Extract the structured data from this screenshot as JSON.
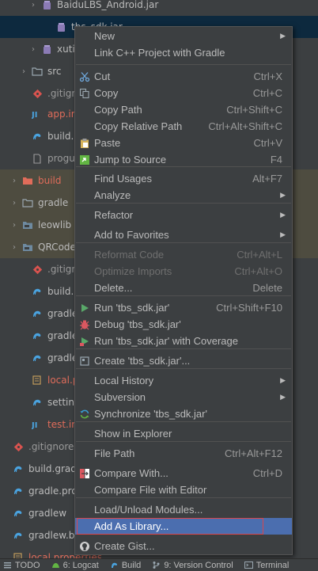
{
  "tree": {
    "rows": [
      {
        "label": "BaiduLBS_Android.jar",
        "icon": "jar-icon",
        "color": "#bbbbbb",
        "arrow": "›"
      },
      {
        "label": "tbs_sdk.jar",
        "icon": "jar-icon",
        "color": "#bbbbbb",
        "arrow": ""
      },
      {
        "label": "xutils",
        "icon": "jar-icon",
        "color": "#bbbbbb",
        "arrow": "›"
      },
      {
        "label": "src",
        "icon": "folder-icon",
        "color": "#bbbbbb",
        "arrow": "›"
      },
      {
        "label": ".gitignore",
        "icon": "gitignore-icon",
        "color": "#9a9a9a",
        "arrow": ""
      },
      {
        "label": "app.iml",
        "icon": "iml-icon",
        "color": "#e06c5a",
        "arrow": ""
      },
      {
        "label": "build.gradle",
        "icon": "gradle-icon",
        "color": "#bbbbbb",
        "arrow": ""
      },
      {
        "label": "proguard-rules.pro",
        "icon": "file-icon",
        "color": "#9a9a9a",
        "arrow": ""
      },
      {
        "label": "build",
        "icon": "folder-red-icon",
        "color": "#e06c5a",
        "arrow": "›"
      },
      {
        "label": "gradle",
        "icon": "folder-icon",
        "color": "#bbbbbb",
        "arrow": "›"
      },
      {
        "label": "leowlib",
        "icon": "module-icon",
        "color": "#bbbbbb",
        "arrow": "›"
      },
      {
        "label": "QRCodeLib",
        "icon": "module-icon",
        "color": "#bbbbbb",
        "arrow": "›"
      },
      {
        "label": ".gitignore",
        "icon": "gitignore-icon",
        "color": "#9a9a9a",
        "arrow": ""
      },
      {
        "label": "build.gradle",
        "icon": "gradle-icon",
        "color": "#bbbbbb",
        "arrow": ""
      },
      {
        "label": "gradle.properties",
        "icon": "gradle-icon",
        "color": "#bbbbbb",
        "arrow": ""
      },
      {
        "label": "gradlew",
        "icon": "gradle-icon",
        "color": "#bbbbbb",
        "arrow": ""
      },
      {
        "label": "gradlew.bat",
        "icon": "gradle-icon",
        "color": "#bbbbbb",
        "arrow": ""
      },
      {
        "label": "local.properties",
        "icon": "properties-icon",
        "color": "#e06c5a",
        "arrow": ""
      },
      {
        "label": "settings.gradle",
        "icon": "gradle-icon",
        "color": "#bbbbbb",
        "arrow": ""
      },
      {
        "label": "test.iml",
        "icon": "iml-icon",
        "color": "#e06c5a",
        "arrow": ""
      },
      {
        "label": ".gitignore",
        "icon": "gitignore-icon",
        "color": "#9a9a9a",
        "arrow": ""
      },
      {
        "label": "build.gradle",
        "icon": "gradle-icon",
        "color": "#bbbbbb",
        "arrow": ""
      },
      {
        "label": "gradle.properties",
        "icon": "gradle-icon",
        "color": "#bbbbbb",
        "arrow": ""
      },
      {
        "label": "gradlew",
        "icon": "gradle-icon",
        "color": "#bbbbbb",
        "arrow": ""
      },
      {
        "label": "gradlew.bat",
        "icon": "gradle-icon",
        "color": "#bbbbbb",
        "arrow": ""
      },
      {
        "label": "local.properties",
        "icon": "properties-icon",
        "color": "#e06c5a",
        "arrow": ""
      }
    ]
  },
  "menu": {
    "items": [
      {
        "label": "New",
        "shortcut": "",
        "submenu": true,
        "icon": ""
      },
      {
        "label": "Link C++ Project with Gradle",
        "shortcut": "",
        "submenu": false,
        "icon": ""
      },
      {
        "label": "Cut",
        "shortcut": "Ctrl+X",
        "submenu": false,
        "icon": "scissors-icon"
      },
      {
        "label": "Copy",
        "shortcut": "Ctrl+C",
        "submenu": false,
        "icon": "copy-icon"
      },
      {
        "label": "Copy Path",
        "shortcut": "Ctrl+Shift+C",
        "submenu": false,
        "icon": ""
      },
      {
        "label": "Copy Relative Path",
        "shortcut": "Ctrl+Alt+Shift+C",
        "submenu": false,
        "icon": ""
      },
      {
        "label": "Paste",
        "shortcut": "Ctrl+V",
        "submenu": false,
        "icon": "paste-icon"
      },
      {
        "label": "Jump to Source",
        "shortcut": "F4",
        "submenu": false,
        "icon": "jump-icon"
      },
      {
        "label": "Find Usages",
        "shortcut": "Alt+F7",
        "submenu": false,
        "icon": ""
      },
      {
        "label": "Analyze",
        "shortcut": "",
        "submenu": true,
        "icon": ""
      },
      {
        "label": "Refactor",
        "shortcut": "",
        "submenu": true,
        "icon": ""
      },
      {
        "label": "Add to Favorites",
        "shortcut": "",
        "submenu": true,
        "icon": ""
      },
      {
        "label": "Reformat Code",
        "shortcut": "Ctrl+Alt+L",
        "submenu": false,
        "icon": "",
        "disabled": true
      },
      {
        "label": "Optimize Imports",
        "shortcut": "Ctrl+Alt+O",
        "submenu": false,
        "icon": "",
        "disabled": true
      },
      {
        "label": "Delete...",
        "shortcut": "Delete",
        "submenu": false,
        "icon": ""
      },
      {
        "label": "Run 'tbs_sdk.jar'",
        "shortcut": "Ctrl+Shift+F10",
        "submenu": false,
        "icon": "run-icon"
      },
      {
        "label": "Debug 'tbs_sdk.jar'",
        "shortcut": "",
        "submenu": false,
        "icon": "debug-icon"
      },
      {
        "label": "Run 'tbs_sdk.jar' with Coverage",
        "shortcut": "",
        "submenu": false,
        "icon": "coverage-icon"
      },
      {
        "label": "Create 'tbs_sdk.jar'...",
        "shortcut": "",
        "submenu": false,
        "icon": "create-config-icon"
      },
      {
        "label": "Local History",
        "shortcut": "",
        "submenu": true,
        "icon": ""
      },
      {
        "label": "Subversion",
        "shortcut": "",
        "submenu": true,
        "icon": ""
      },
      {
        "label": "Synchronize 'tbs_sdk.jar'",
        "shortcut": "",
        "submenu": false,
        "icon": "sync-icon"
      },
      {
        "label": "Show in Explorer",
        "shortcut": "",
        "submenu": false,
        "icon": ""
      },
      {
        "label": "File Path",
        "shortcut": "Ctrl+Alt+F12",
        "submenu": false,
        "icon": ""
      },
      {
        "label": "Compare With...",
        "shortcut": "Ctrl+D",
        "submenu": false,
        "icon": "compare-icon"
      },
      {
        "label": "Compare File with Editor",
        "shortcut": "",
        "submenu": false,
        "icon": ""
      },
      {
        "label": "Load/Unload Modules...",
        "shortcut": "",
        "submenu": false,
        "icon": ""
      },
      {
        "label": "Add As Library...",
        "shortcut": "",
        "submenu": false,
        "icon": "",
        "active": true
      },
      {
        "label": "Create Gist...",
        "shortcut": "",
        "submenu": false,
        "icon": "github-icon"
      }
    ]
  },
  "toolbar": {
    "items": [
      {
        "label": "TODO",
        "icon": "todo-icon"
      },
      {
        "label": "6: Logcat",
        "icon": "logcat-icon"
      },
      {
        "label": "Build",
        "icon": "build-icon"
      },
      {
        "label": "9: Version Control",
        "icon": "version-control-icon"
      },
      {
        "label": "Terminal",
        "icon": "terminal-icon"
      }
    ]
  },
  "colors": {
    "background": "#3c3f41",
    "selection": "#4b6eaf",
    "focus_outline": "#d9464d",
    "ignored_text": "#e06c5a",
    "highlight_row": "#4e4c40"
  }
}
